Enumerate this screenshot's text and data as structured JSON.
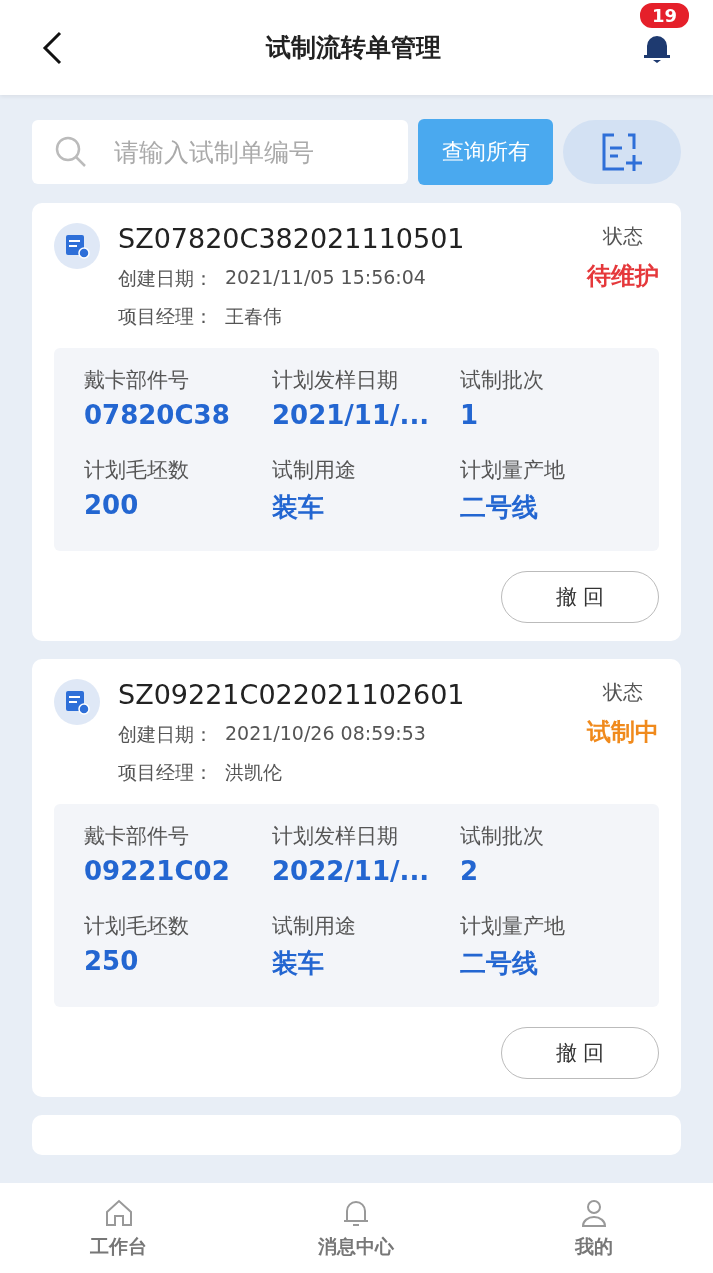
{
  "header": {
    "title": "试制流转单管理",
    "notification_count": "19"
  },
  "search": {
    "placeholder": "请输入试制单编号",
    "query_button": "查询所有"
  },
  "orders": [
    {
      "number": "SZ07820C382021110501",
      "status_label": "状态",
      "status": "待维护",
      "color": "#e5383b",
      "created_label": "创建日期：",
      "created": "2021/11/05 15:56:04",
      "manager_label": "项目经理：",
      "manager": "王春伟",
      "fields": [
        {
          "label": "戴卡部件号",
          "value": "07820C38"
        },
        {
          "label": "计划发样日期",
          "value": "2021/11/..."
        },
        {
          "label": "试制批次",
          "value": "1"
        },
        {
          "label": "计划毛坯数",
          "value": "200"
        },
        {
          "label": "试制用途",
          "value": "装车"
        },
        {
          "label": "计划量产地",
          "value": "二号线"
        }
      ],
      "action": "撤 回"
    },
    {
      "number": "SZ09221C022021102601",
      "status_label": "状态",
      "status": "试制中",
      "color": "#f08a1c",
      "created_label": "创建日期：",
      "created": "2021/10/26 08:59:53",
      "manager_label": "项目经理：",
      "manager": "洪凯伦",
      "fields": [
        {
          "label": "戴卡部件号",
          "value": "09221C02"
        },
        {
          "label": "计划发样日期",
          "value": "2022/11/..."
        },
        {
          "label": "试制批次",
          "value": "2"
        },
        {
          "label": "计划毛坯数",
          "value": "250"
        },
        {
          "label": "试制用途",
          "value": "装车"
        },
        {
          "label": "计划量产地",
          "value": "二号线"
        }
      ],
      "action": "撤 回"
    }
  ],
  "tabs": [
    {
      "label": "工作台",
      "kind": "home"
    },
    {
      "label": "消息中心",
      "kind": "bell"
    },
    {
      "label": "我的",
      "kind": "user"
    }
  ]
}
